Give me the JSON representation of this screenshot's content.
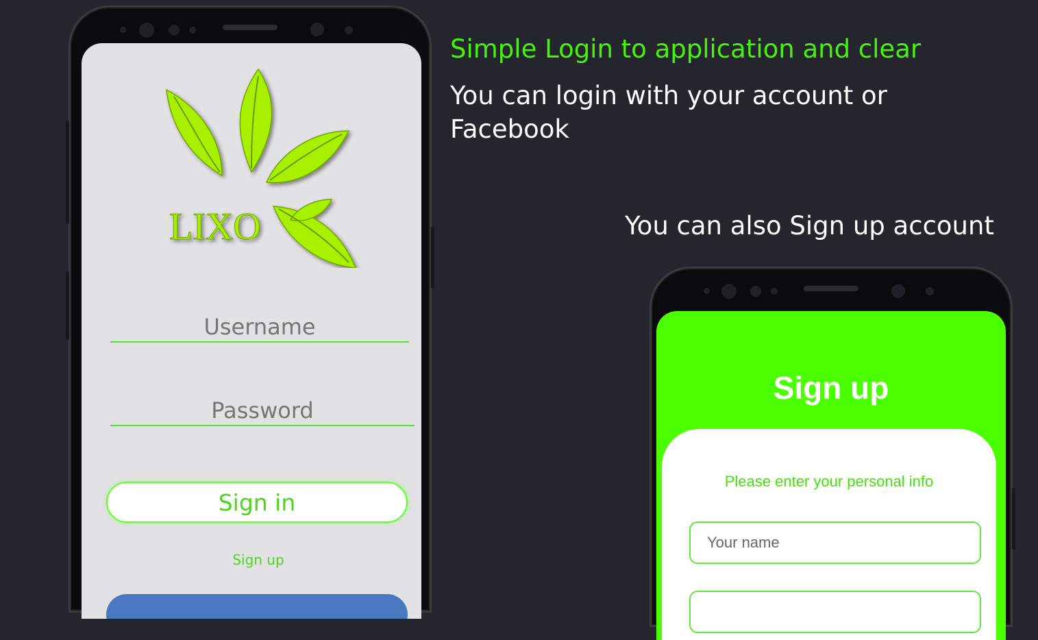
{
  "captions": {
    "title": "Simple Login to application and clear",
    "login_text": "You can login with your account or Facebook",
    "signup_text": "You can also Sign up account"
  },
  "login_screen": {
    "logo_text": "LIXO",
    "username_placeholder": "Username",
    "password_placeholder": "Password",
    "signin_label": "Sign in",
    "signup_link": "Sign up"
  },
  "signup_screen": {
    "title": "Sign up",
    "subtitle": "Please enter your personal info",
    "name_placeholder": "Your name"
  },
  "colors": {
    "background": "#24252d",
    "accent_green": "#4bff00",
    "logo_green": "#a8f000",
    "facebook_blue": "#4a78c0"
  },
  "icons": [
    "leaf-logo-icon"
  ]
}
